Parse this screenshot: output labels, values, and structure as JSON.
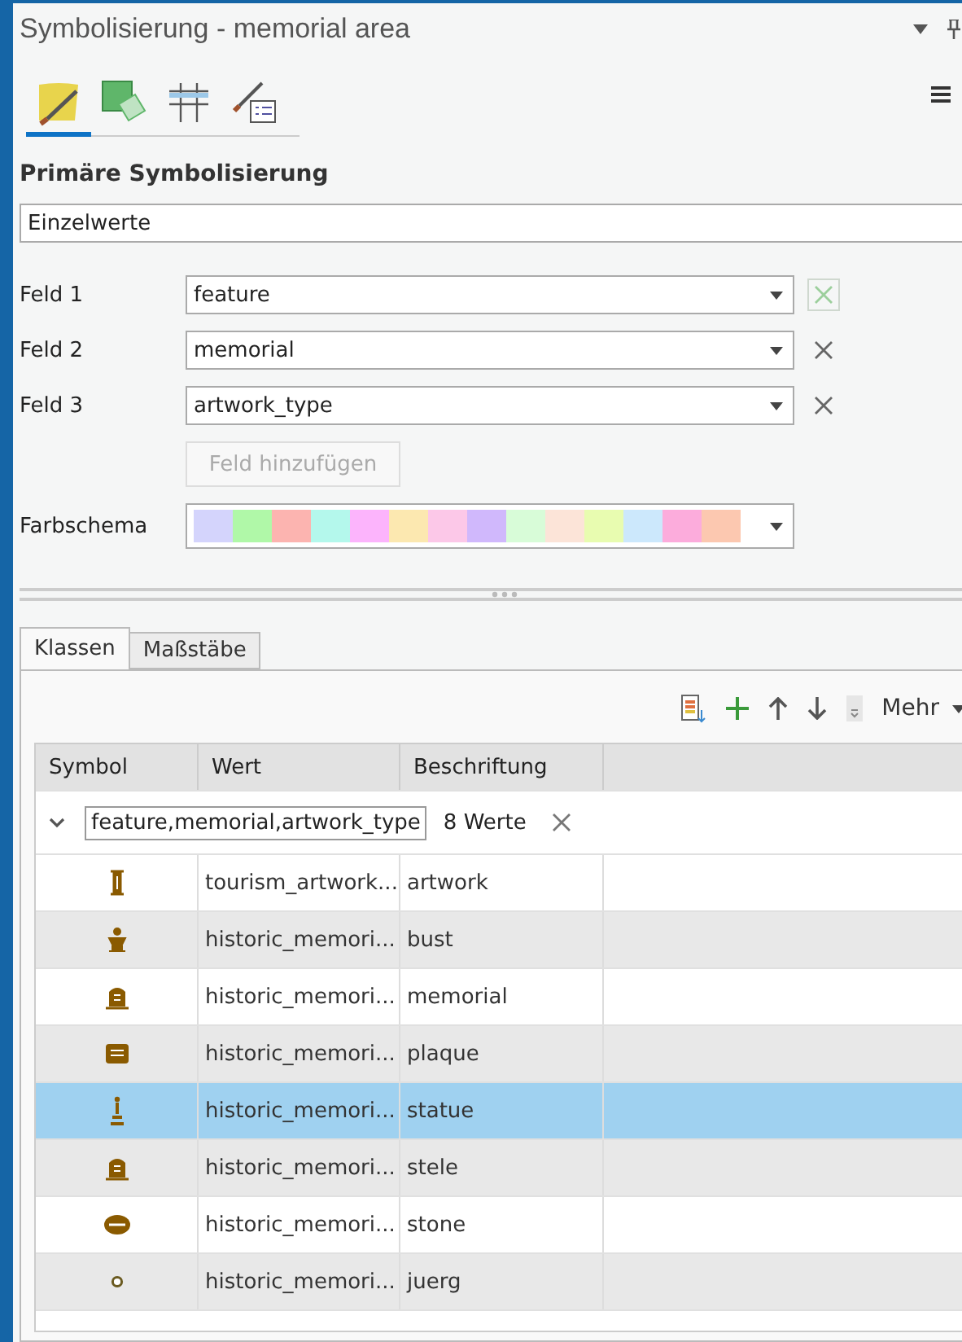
{
  "pane": {
    "title": "Symbolisierung - memorial area"
  },
  "icon_tabs": [
    {
      "kind": "primary",
      "selected": true
    },
    {
      "kind": "vary",
      "selected": false
    },
    {
      "kind": "labels",
      "selected": false
    },
    {
      "kind": "attributes",
      "selected": false
    }
  ],
  "primary": {
    "heading": "Primäre Symbolisierung",
    "method": "Einzelwerte",
    "fields": [
      {
        "label": "Feld 1",
        "value": "feature",
        "remove_disabled": true
      },
      {
        "label": "Feld 2",
        "value": "memorial",
        "remove_disabled": false
      },
      {
        "label": "Feld 3",
        "value": "artwork_type",
        "remove_disabled": false
      }
    ],
    "add_field": {
      "label": "Feld hinzufügen",
      "disabled": true
    },
    "color_scheme": {
      "label": "Farbschema",
      "swatches": [
        {
          "color": "#d4d4fc"
        },
        {
          "color": "#b0f8a8"
        },
        {
          "color": "#fcb4b0"
        },
        {
          "color": "#b4f8ec"
        },
        {
          "color": "#fcb4fc"
        },
        {
          "color": "#fce8b0"
        },
        {
          "color": "#fcc8e8"
        },
        {
          "color": "#d0b8fc"
        },
        {
          "color": "#d8fcd8"
        },
        {
          "color": "#fce4d8"
        },
        {
          "color": "#e8fcb0"
        },
        {
          "color": "#cce8fc"
        },
        {
          "color": "#fcacdc"
        },
        {
          "color": "#fcc8b0"
        }
      ]
    }
  },
  "class_tabs": [
    {
      "label": "Klassen",
      "selected": true
    },
    {
      "label": "Maßstäbe",
      "selected": false
    }
  ],
  "toolbar": {
    "more": "Mehr"
  },
  "table": {
    "columns": [
      "Symbol",
      "Wert",
      "Beschriftung"
    ],
    "group": {
      "expanded": true,
      "fields": "feature,memorial,artwork_type",
      "count": "8 Werte"
    },
    "rows": [
      {
        "kind": "artwork",
        "value": "tourism_artwork...",
        "label": "artwork",
        "selected": false
      },
      {
        "kind": "bust",
        "value": "historic_memori...",
        "label": "bust",
        "selected": false
      },
      {
        "kind": "tablet",
        "value": "historic_memori...",
        "label": "memorial",
        "selected": false
      },
      {
        "kind": "plaque",
        "value": "historic_memori...",
        "label": "plaque",
        "selected": false
      },
      {
        "kind": "statue",
        "value": "historic_memori...",
        "label": "statue",
        "selected": true
      },
      {
        "kind": "tablet",
        "value": "historic_memori...",
        "label": "stele",
        "selected": false
      },
      {
        "kind": "stone",
        "value": "historic_memori...",
        "label": "stone",
        "selected": false
      },
      {
        "kind": "ring",
        "value": "historic_memori...",
        "label": "juerg",
        "selected": false
      }
    ]
  }
}
